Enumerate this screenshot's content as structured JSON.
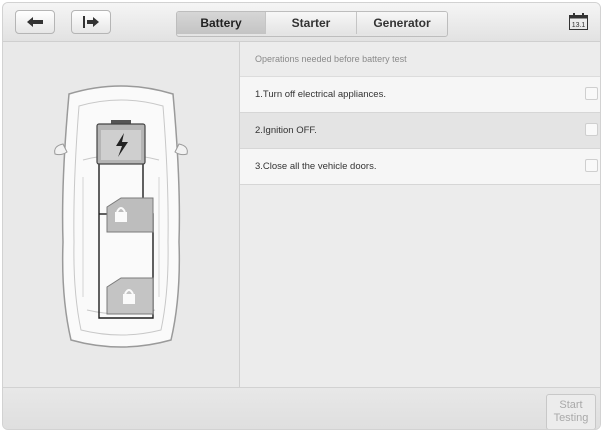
{
  "toolbar": {
    "back_icon": "back-arrow-icon",
    "exit_icon": "exit-icon",
    "calendar_icon": "calendar-icon",
    "calendar_label": "13.1"
  },
  "tabs": [
    {
      "label": "Battery",
      "active": true
    },
    {
      "label": "Starter",
      "active": false
    },
    {
      "label": "Generator",
      "active": false
    }
  ],
  "operations": {
    "header": "Operations needed before battery test",
    "items": [
      {
        "label": "1.Turn off electrical appliances.",
        "checked": false
      },
      {
        "label": "2.Ignition OFF.",
        "checked": false
      },
      {
        "label": "3.Close all the vehicle doors.",
        "checked": false
      }
    ]
  },
  "illustration": {
    "icons": [
      "car-top-view-icon",
      "battery-icon",
      "locked-door-icon",
      "locked-door-icon"
    ],
    "battery_color": "#b5b5b5",
    "wire_color": "#1e1e1e"
  },
  "footer": {
    "start_line1": "Start",
    "start_line2": "Testing",
    "start_enabled": false
  }
}
